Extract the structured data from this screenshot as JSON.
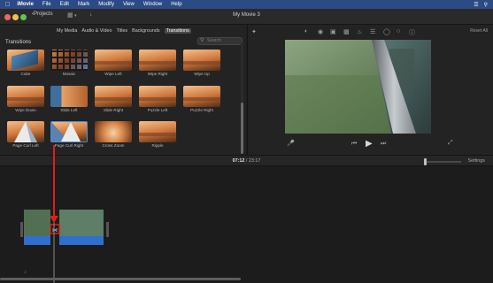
{
  "menubar": {
    "apple": "",
    "app": "iMovie",
    "items": [
      "File",
      "Edit",
      "Mark",
      "Modify",
      "View",
      "Window",
      "Help"
    ]
  },
  "titlebar": {
    "projects": "Projects",
    "title": "My Movie 3"
  },
  "browser": {
    "tabs": [
      "My Media",
      "Audio & Video",
      "Titles",
      "Backgrounds",
      "Transitions"
    ],
    "active_tab": "Transitions",
    "section_title": "Transitions",
    "search_placeholder": "Search",
    "transitions": [
      {
        "label": "Cube"
      },
      {
        "label": "Mosaic"
      },
      {
        "label": "Wipe Left"
      },
      {
        "label": "Wipe Right"
      },
      {
        "label": "Wipe Up"
      },
      {
        "label": "Wipe Down"
      },
      {
        "label": "Slide Left"
      },
      {
        "label": "Slide Right"
      },
      {
        "label": "Puzzle Left"
      },
      {
        "label": "Puzzle Right"
      },
      {
        "label": "Page Curl Left"
      },
      {
        "label": "Page Curl Right"
      },
      {
        "label": "Cross Zoom"
      },
      {
        "label": "Ripple"
      }
    ]
  },
  "viewer": {
    "reset_all": "Reset All"
  },
  "playback": {
    "current": "07:12",
    "separator": "/",
    "total": "23:17",
    "settings": "Settings"
  },
  "colors": {
    "menubar": "#2b4a86",
    "annotation_red": "#e0201c",
    "audio_blue": "#2f6fd0",
    "active_tab": "#4a4a4a"
  }
}
